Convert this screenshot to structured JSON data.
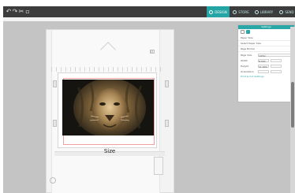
{
  "toolbar": {
    "icons": [
      "undo-icon",
      "redo-icon",
      "cut-icon",
      "panel-icon"
    ],
    "glyphs": [
      "↶",
      "↷",
      "✂",
      "▫"
    ],
    "tabs": [
      {
        "label": "DESIGN",
        "icon": "design-icon"
      },
      {
        "label": "STORE",
        "icon": "store-icon"
      },
      {
        "label": "LIBRARY",
        "icon": "library-icon"
      },
      {
        "label": "SEND",
        "icon": "send-icon"
      }
    ],
    "active_tab": "DESIGN"
  },
  "canvas": {
    "size_label": "Size",
    "image_subject": "lion portrait photo"
  },
  "panel": {
    "title": "Settings",
    "rows": [
      "Paper Size",
      "Select Paper Size",
      "Page Border"
    ],
    "fields": [
      {
        "label": "Page Size",
        "value": "Letter"
      },
      {
        "label": "Width",
        "value": "8.500"
      },
      {
        "label": "Height",
        "value": "11.000"
      },
      {
        "label": "Orientation",
        "value": ""
      }
    ],
    "link": "Print & Cut Settings"
  },
  "colors": {
    "accent": "#2aa8a8",
    "toolbar": "#3c3c3c",
    "workspace": "#c4c4c4",
    "page_border": "#f0a0a0"
  }
}
